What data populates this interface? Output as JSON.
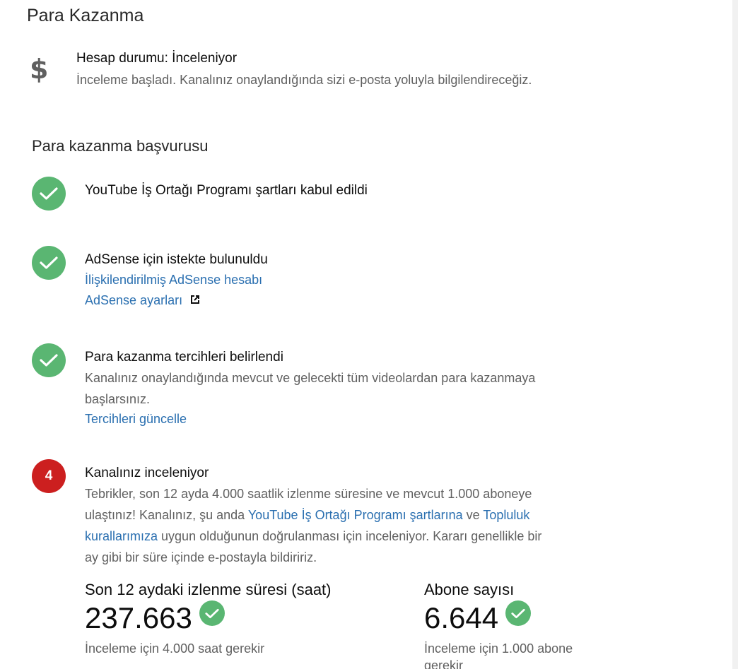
{
  "page_title": "Para Kazanma",
  "account_status": {
    "icon": "dollar-icon",
    "icon_glyph": "$",
    "title": "Hesap durumu: İnceleniyor",
    "description": "İnceleme başladı. Kanalınız onaylandığında sizi e-posta yoluyla bilgilendireceğiz."
  },
  "application": {
    "title": "Para kazanma başvurusu",
    "steps": [
      {
        "status": "done",
        "title": "YouTube İş Ortağı Programı şartları kabul edildi"
      },
      {
        "status": "done",
        "title": "AdSense için istekte bulunuldu",
        "links": [
          "İlişkilendirilmiş AdSense hesabı",
          "AdSense ayarları"
        ]
      },
      {
        "status": "done",
        "title": "Para kazanma tercihleri belirlendi",
        "text_line_1": "Kanalınız onaylandığında mevcut ve gelecekti tüm videolardan para kazanmaya",
        "text_line_2": "başlarsınız.",
        "link": "Tercihleri güncelle"
      },
      {
        "status": "current",
        "number": "4",
        "title": "Kanalınız inceleniyor",
        "text_line_1": "Tebrikler, son 12 ayda 4.000 saatlik izlenme süresine ve mevcut 1.000 aboneye",
        "text_line_2_a": "ulaştınız! Kanalınız, şu anda ",
        "link_ypp": "YouTube İş Ortağı Programı şartlarına",
        "text_line_2_b": " ve ",
        "link_guidelines_a": "Topluluk",
        "link_guidelines_b": "kurallarımıza",
        "text_line_3": " uygun olduğunun doğrulanması için inceleniyor. Kararı genellikle bir",
        "text_line_4": "ay gibi bir süre içinde e-postayla bildiririz."
      }
    ]
  },
  "metrics": {
    "watch_hours": {
      "label": "Son 12 aydaki izlenme süresi (saat)",
      "value": "237.663",
      "note": "İnceleme için 4.000 saat gerekir"
    },
    "subscribers": {
      "label": "Abone sayısı",
      "value": "6.644",
      "note_line_1": "İnceleme için 1.000 abone",
      "note_line_2": "gerekir"
    }
  },
  "colors": {
    "done": "#5ab672",
    "current": "#cc1f1f",
    "link": "#2a6fb0"
  }
}
